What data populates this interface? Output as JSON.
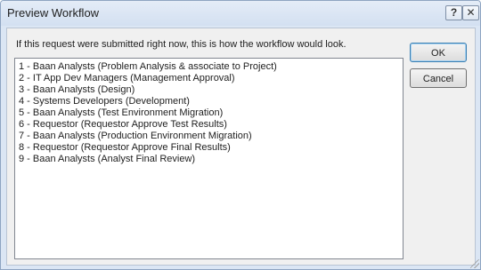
{
  "window": {
    "title": "Preview Workflow",
    "help_label": "?",
    "close_label": "✕"
  },
  "instruction": "If this request were submitted right now, this is how the workflow would look.",
  "workflow_steps": [
    "1 - Baan Analysts (Problem Analysis & associate to Project)",
    "2 - IT App Dev Managers (Management Approval)",
    "3 - Baan Analysts (Design)",
    "4 - Systems Developers (Development)",
    "5 - Baan Analysts (Test Environment Migration)",
    "6 - Requestor (Requestor Approve Test Results)",
    "7 - Baan Analysts (Production Environment Migration)",
    "8 - Requestor (Requestor Approve Final Results)",
    "9 - Baan Analysts (Analyst Final Review)"
  ],
  "buttons": {
    "ok_label": "OK",
    "cancel_label": "Cancel"
  }
}
